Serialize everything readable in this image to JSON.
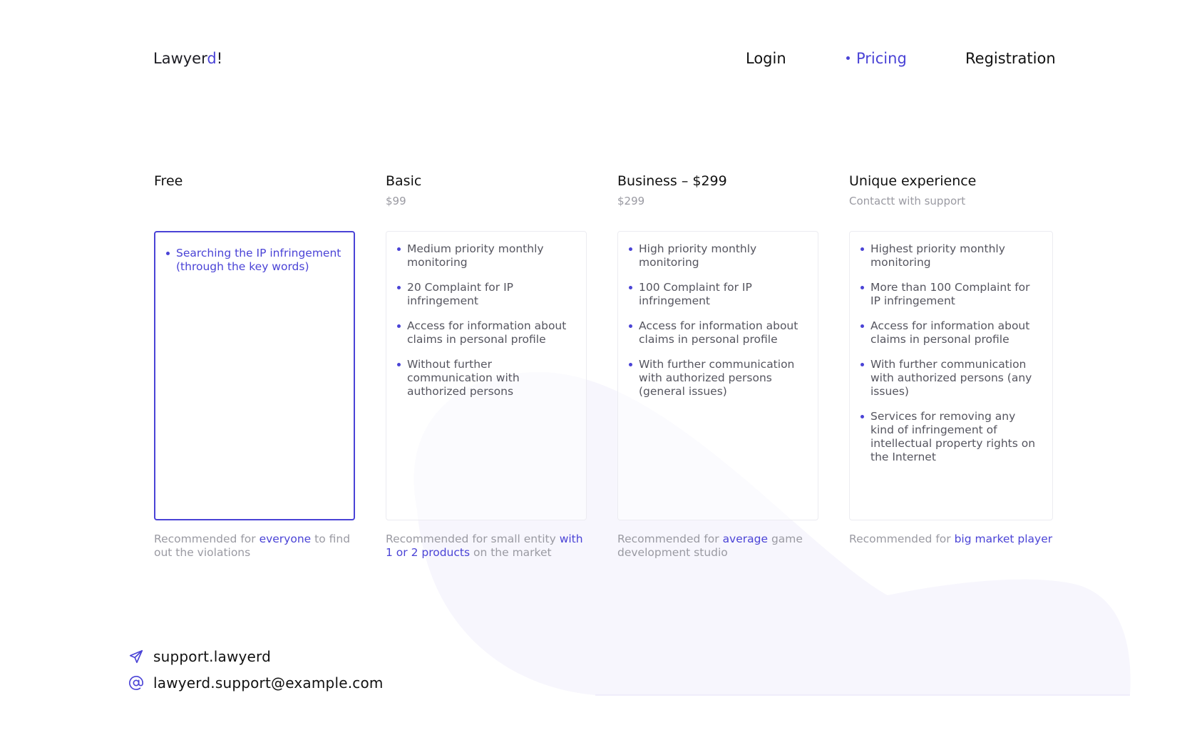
{
  "brand": {
    "name_part1": "Lawyer",
    "name_accent": "d",
    "name_part2": "!"
  },
  "nav": {
    "items": [
      {
        "label": "Login",
        "active": false
      },
      {
        "label": "Pricing",
        "active": true
      },
      {
        "label": "Registration",
        "active": false
      }
    ]
  },
  "plans": [
    {
      "name": "Free",
      "price": "",
      "selected": true,
      "features": [
        "Searching the IP infringement (through the key words)"
      ],
      "recommend": {
        "pre": "Recommended for ",
        "highlight": "everyone",
        "post": " to find out the violations"
      }
    },
    {
      "name": "Basic",
      "price": "$99",
      "selected": false,
      "features": [
        "Medium priority monthly monitoring",
        "20  Complaint for IP infringement",
        "Access for information about claims in personal profile",
        "Without further communication with authorized persons"
      ],
      "recommend": {
        "pre": "Recommended for small entity ",
        "highlight": "with 1 or 2 products",
        "post": " on the market"
      }
    },
    {
      "name": "Business – $299",
      "price": "$299",
      "selected": false,
      "features": [
        "High priority monthly monitoring",
        "100 Complaint for IP infringement",
        "Access for information about claims in personal profile",
        "With further communication with authorized persons (general issues)"
      ],
      "recommend": {
        "pre": "Recommended for ",
        "highlight": "average",
        "post": " game development studio"
      }
    },
    {
      "name": "Unique experience",
      "price": "Contactt with support",
      "selected": false,
      "features": [
        "Highest priority monthly monitoring",
        "More than 100 Complaint for IP infringement",
        "Access for information about claims in personal profile",
        "With further communication with authorized persons (any issues)",
        "Services for removing any kind of infringement of intellectual property rights on the Internet"
      ],
      "recommend": {
        "pre": "Recommended for ",
        "highlight": "big market player",
        "post": ""
      }
    }
  ],
  "contacts": {
    "telegram": {
      "icon": "paper-plane-icon",
      "label": "support.lawyerd"
    },
    "email": {
      "icon": "at-sign-icon",
      "label": "lawyerd.support@example.com"
    }
  },
  "colors": {
    "accent": "#4a43d6",
    "muted": "#9a9aa2",
    "blob": "#f7f6fd"
  }
}
